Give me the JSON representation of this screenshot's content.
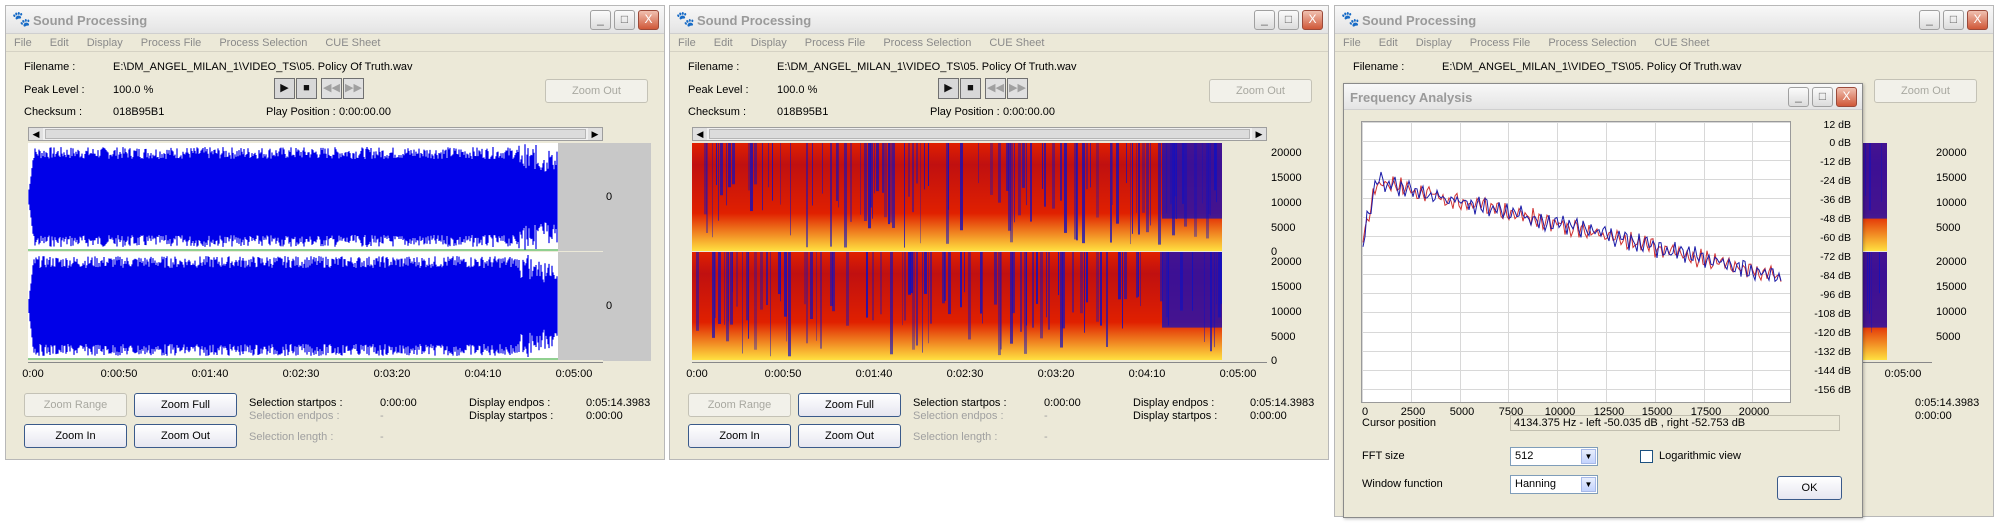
{
  "window": {
    "title": "Sound Processing",
    "menu": [
      "File",
      "Edit",
      "Display",
      "Process File",
      "Process Selection",
      "CUE Sheet"
    ],
    "buttons": {
      "minimize": "_",
      "maximize": "□",
      "close": "X"
    }
  },
  "info": {
    "filename_label": "Filename :",
    "filename_value": "E:\\DM_ANGEL_MILAN_1\\VIDEO_TS\\05. Policy Of Truth.wav",
    "peak_label": "Peak Level :",
    "peak_value": "100.0 %",
    "checksum_label": "Checksum :",
    "checksum_value": "018B95B1",
    "play_label": "Play Position :",
    "play_value": "0:00:00.00"
  },
  "transport": [
    "▶",
    "■",
    "◀◀",
    "▶▶"
  ],
  "zoom_out_top": "Zoom Out",
  "zero": "0",
  "time_ticks": [
    "0:00",
    "0:00:50",
    "0:01:40",
    "0:02:30",
    "0:03:20",
    "0:04:10",
    "0:05:00"
  ],
  "freq_ticks": [
    "20000",
    "15000",
    "10000",
    "5000",
    "0"
  ],
  "bottom": {
    "zoom_range": "Zoom Range",
    "zoom_full": "Zoom Full",
    "zoom_in": "Zoom In",
    "zoom_out": "Zoom Out",
    "sel_start_label": "Selection startpos :",
    "sel_start_value": "0:00:00",
    "sel_end_label": "Selection endpos :",
    "sel_end_value": "-",
    "sel_len_label": "Selection length :",
    "sel_len_value": "-",
    "disp_end_label": "Display endpos :",
    "disp_end_value": "0:05:14.3983",
    "disp_start_label": "Display startpos :",
    "disp_start_value": "0:00:00"
  },
  "freq": {
    "title": "Frequency Analysis",
    "db_ticks": [
      "12 dB",
      "0 dB",
      "-12 dB",
      "-24 dB",
      "-36 dB",
      "-48 dB",
      "-60 dB",
      "-72 dB",
      "-84 dB",
      "-96 dB",
      "-108 dB",
      "-120 dB",
      "-132 dB",
      "-144 dB",
      "-156 dB"
    ],
    "x_ticks": [
      "0",
      "2500",
      "5000",
      "7500",
      "10000",
      "12500",
      "15000",
      "17500",
      "20000"
    ],
    "cursor_label": "Cursor position",
    "cursor_value": "4134.375 Hz  -  left -50.035 dB , right -52.753 dB",
    "fft_label": "FFT size",
    "fft_value": "512",
    "log_label": "Logarithmic view",
    "window_label": "Window function",
    "window_value": "Hanning",
    "ok": "OK",
    "series_colors": {
      "left": "#1a1aa8",
      "right": "#d03030"
    }
  },
  "colors": {
    "waveform": "#0000e8",
    "spectro_hot": "#ffe040",
    "spectro_mid": "#e02000",
    "spectro_cold": "#1010c0"
  }
}
